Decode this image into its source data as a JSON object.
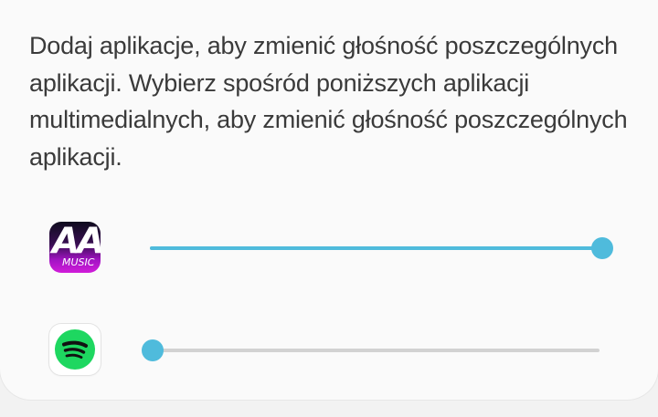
{
  "description": "Dodaj aplikacje, aby zmienić głośność poszczególnych aplikacji. Wybierz spośród poniższych aplikacji multimedialnych, aby zmienić głośność poszczególnych aplikacji.",
  "colors": {
    "accent": "#4fbbdc",
    "track": "#d2d2d2",
    "text": "#3a3a3a",
    "spotify_green": "#1ed760"
  },
  "apps": [
    {
      "icon": "aa-music-icon",
      "icon_text": "AA",
      "icon_subtext": "MUSIC",
      "volume_fraction": 1.0
    },
    {
      "icon": "spotify-icon",
      "volume_fraction": 0.0
    }
  ]
}
